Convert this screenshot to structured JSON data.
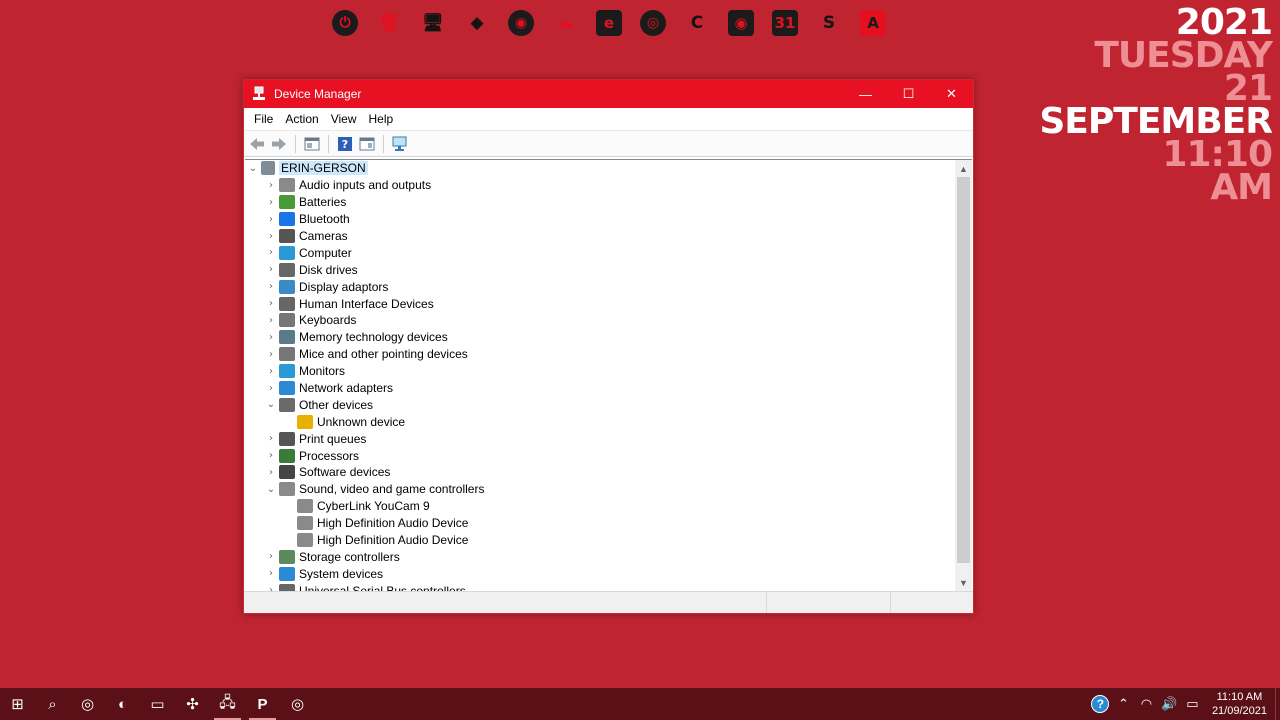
{
  "dock": {
    "items": [
      {
        "name": "power-icon",
        "glyph": "⏻",
        "style": "circle"
      },
      {
        "name": "trash-icon",
        "glyph": "🗑",
        "style": "red"
      },
      {
        "name": "monitor-icon",
        "glyph": "🖥",
        "style": "dark"
      },
      {
        "name": "box-icon",
        "glyph": "◆",
        "style": "dark"
      },
      {
        "name": "camera-icon",
        "glyph": "◉",
        "style": "circle"
      },
      {
        "name": "cloud-icon",
        "glyph": "☁",
        "style": "red"
      },
      {
        "name": "edge-icon",
        "glyph": "e",
        "style": "tile"
      },
      {
        "name": "chrome-icon",
        "glyph": "◎",
        "style": "circle"
      },
      {
        "name": "ccleaner-icon",
        "glyph": "C",
        "style": "dark"
      },
      {
        "name": "disc-icon",
        "glyph": "◉",
        "style": "tile"
      },
      {
        "name": "calendar-icon",
        "glyph": "31",
        "style": "tile"
      },
      {
        "name": "sketchup-icon",
        "glyph": "S",
        "style": "dark"
      },
      {
        "name": "autocad-icon",
        "glyph": "A",
        "style": "tile redbg"
      }
    ]
  },
  "clock_widget": {
    "year": "2021",
    "weekday": "TUESDAY",
    "day": "21",
    "month": "SEPTEMBER",
    "time": "11:10",
    "ampm": "AM"
  },
  "window": {
    "title": "Device Manager",
    "controls": {
      "minimize": "—",
      "maximize": "☐",
      "close": "✕"
    },
    "menu": [
      "File",
      "Action",
      "View",
      "Help"
    ],
    "root": "ERIN-GERSON",
    "tree": [
      {
        "label": "Audio inputs and outputs",
        "level": 1,
        "expanded": false,
        "color": "#8a8a8a"
      },
      {
        "label": "Batteries",
        "level": 1,
        "expanded": false,
        "color": "#4a9a3a"
      },
      {
        "label": "Bluetooth",
        "level": 1,
        "expanded": false,
        "color": "#1a73e8"
      },
      {
        "label": "Cameras",
        "level": 1,
        "expanded": false,
        "color": "#555555"
      },
      {
        "label": "Computer",
        "level": 1,
        "expanded": false,
        "color": "#2a9ad6"
      },
      {
        "label": "Disk drives",
        "level": 1,
        "expanded": false,
        "color": "#666666"
      },
      {
        "label": "Display adaptors",
        "level": 1,
        "expanded": false,
        "color": "#3a8ac8"
      },
      {
        "label": "Human Interface Devices",
        "level": 1,
        "expanded": false,
        "color": "#666666"
      },
      {
        "label": "Keyboards",
        "level": 1,
        "expanded": false,
        "color": "#777777"
      },
      {
        "label": "Memory technology devices",
        "level": 1,
        "expanded": false,
        "color": "#5a7a8a"
      },
      {
        "label": "Mice and other pointing devices",
        "level": 1,
        "expanded": false,
        "color": "#777777"
      },
      {
        "label": "Monitors",
        "level": 1,
        "expanded": false,
        "color": "#2a9ad6"
      },
      {
        "label": "Network adapters",
        "level": 1,
        "expanded": false,
        "color": "#2a8ad6"
      },
      {
        "label": "Other devices",
        "level": 1,
        "expanded": true,
        "color": "#6a6a6a"
      },
      {
        "label": "Unknown device",
        "level": 2,
        "expanded": null,
        "color": "#e8b000"
      },
      {
        "label": "Print queues",
        "level": 1,
        "expanded": false,
        "color": "#555555"
      },
      {
        "label": "Processors",
        "level": 1,
        "expanded": false,
        "color": "#3a7a3a"
      },
      {
        "label": "Software devices",
        "level": 1,
        "expanded": false,
        "color": "#444444"
      },
      {
        "label": "Sound, video and game controllers",
        "level": 1,
        "expanded": true,
        "color": "#8a8a8a"
      },
      {
        "label": "CyberLink YouCam 9",
        "level": 2,
        "expanded": null,
        "color": "#8a8a8a"
      },
      {
        "label": "High Definition Audio Device",
        "level": 2,
        "expanded": null,
        "color": "#8a8a8a"
      },
      {
        "label": "High Definition Audio Device",
        "level": 2,
        "expanded": null,
        "color": "#8a8a8a"
      },
      {
        "label": "Storage controllers",
        "level": 1,
        "expanded": false,
        "color": "#5a8a5a"
      },
      {
        "label": "System devices",
        "level": 1,
        "expanded": false,
        "color": "#2a8ad6"
      },
      {
        "label": "Universal Serial Bus controllers",
        "level": 1,
        "expanded": false,
        "color": "#666666"
      }
    ]
  },
  "taskbar": {
    "apps": [
      {
        "name": "start-button",
        "glyph": "⊞",
        "active": false
      },
      {
        "name": "search-button",
        "glyph": "⌕",
        "active": false
      },
      {
        "name": "taskbar-chrome",
        "glyph": "◎",
        "active": false
      },
      {
        "name": "taskbar-edge",
        "glyph": "◐",
        "active": false
      },
      {
        "name": "taskbar-file-explorer",
        "glyph": "▭",
        "active": false
      },
      {
        "name": "taskbar-app-misc",
        "glyph": "✣",
        "active": false
      },
      {
        "name": "taskbar-device-manager",
        "glyph": "🖧",
        "active": true
      },
      {
        "name": "taskbar-powerpoint",
        "glyph": "P",
        "active": true
      },
      {
        "name": "taskbar-chrome-2",
        "glyph": "◎",
        "active": false
      }
    ],
    "tray": {
      "help": "?",
      "chevron": "⌃",
      "wifi": "◠",
      "volume": "🔊",
      "battery": "▭",
      "time": "11:10 AM",
      "date": "21/09/2021"
    }
  }
}
